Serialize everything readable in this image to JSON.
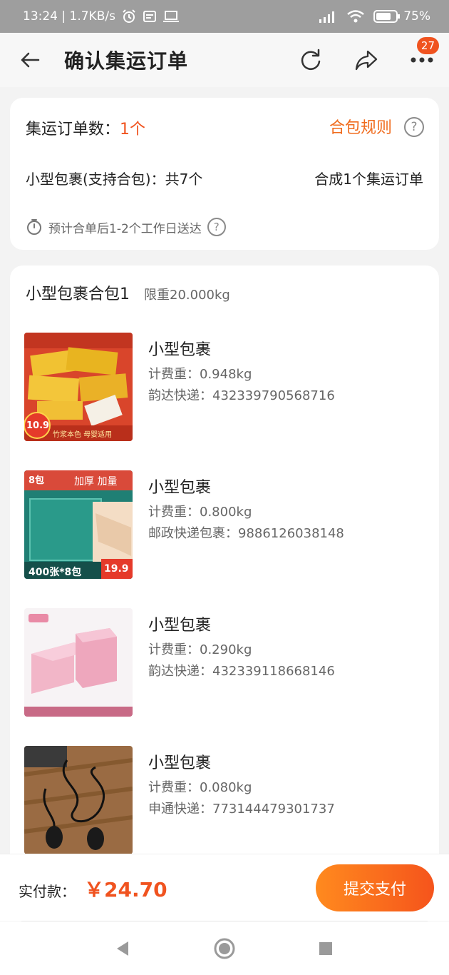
{
  "status_bar": {
    "time_speed": "13:24 | 1.7KB/s",
    "battery": "75%"
  },
  "header": {
    "title": "确认集运订单",
    "badge_count": "27"
  },
  "summary": {
    "order_count_label": "集运订单数：",
    "order_count_value": "1个",
    "rules_label": "合包规则",
    "package_desc": "小型包裹(支持合包)：共7个",
    "merge_result": "合成1个集运订单",
    "estimate": "预计合单后1-2个工作日送达"
  },
  "package_group": {
    "title": "小型包裹合包1",
    "limit": "限重20.000kg",
    "items": [
      {
        "name": "小型包裹",
        "weight": "计费重：0.948kg",
        "tracking": "韵达快递：432339790568716",
        "thumb_desc": "paper-towel-box"
      },
      {
        "name": "小型包裹",
        "weight": "计费重：0.800kg",
        "tracking": "邮政快递包裹：9886126038148",
        "thumb_desc": "tissue-pack"
      },
      {
        "name": "小型包裹",
        "weight": "计费重：0.290kg",
        "tracking": "韵达快递：432339118668146",
        "thumb_desc": "pink-eraser"
      },
      {
        "name": "小型包裹",
        "weight": "计费重：0.080kg",
        "tracking": "申通快递：773144479301737",
        "thumb_desc": "earphones"
      }
    ]
  },
  "thumb_text": {
    "t1_price": "10.9",
    "t1_banner": "竹浆本色 母婴适用",
    "t2_top": "8包",
    "t2_mid": "加厚 加量",
    "t2_bottom": "400张*8包",
    "t2_price": "19.9"
  },
  "pay_bar": {
    "label": "实付款：",
    "amount": "￥24.70",
    "submit": "提交支付"
  },
  "colors": {
    "accent": "#f0531f",
    "accent_gradient_start": "#ff8a1e"
  }
}
